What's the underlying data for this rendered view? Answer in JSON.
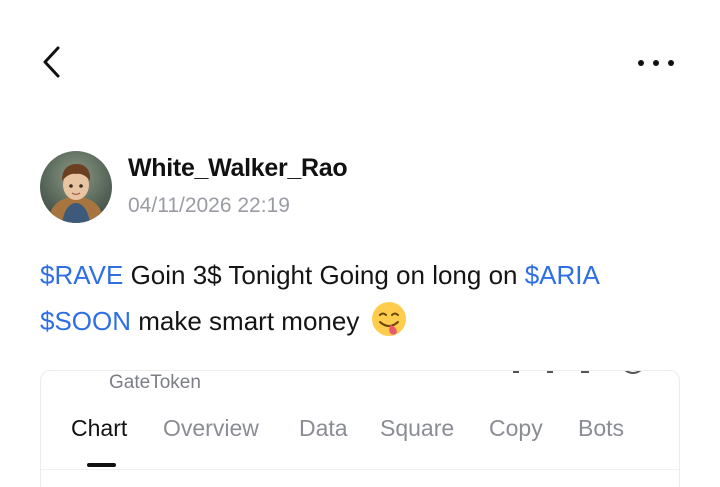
{
  "header": {
    "back_icon": "chevron-left-icon",
    "more_icon": "more-horizontal-icon"
  },
  "post": {
    "author": "White_Walker_Rao",
    "timestamp": "04/11/2026 22:19",
    "body": {
      "line1": [
        {
          "text": "$RAVE",
          "ticker": true
        },
        {
          "text": " Goin 3$ Tonight Going on long on ",
          "ticker": false
        },
        {
          "text": "$ARIA",
          "ticker": true
        }
      ],
      "line2": [
        {
          "text": "$SOON",
          "ticker": true
        },
        {
          "text": " make smart money",
          "ticker": false
        }
      ],
      "emoji": "savoring-face-emoji"
    },
    "colors": {
      "ticker": "#2f6fe6",
      "timestamp": "#9a9ca3"
    }
  },
  "embed_card": {
    "title": "GateToken",
    "tabs": [
      {
        "label": "Chart",
        "active": true
      },
      {
        "label": "Overview",
        "active": false
      },
      {
        "label": "Data",
        "active": false
      },
      {
        "label": "Square",
        "active": false
      },
      {
        "label": "Copy",
        "active": false
      },
      {
        "label": "Bots",
        "active": false
      }
    ]
  }
}
